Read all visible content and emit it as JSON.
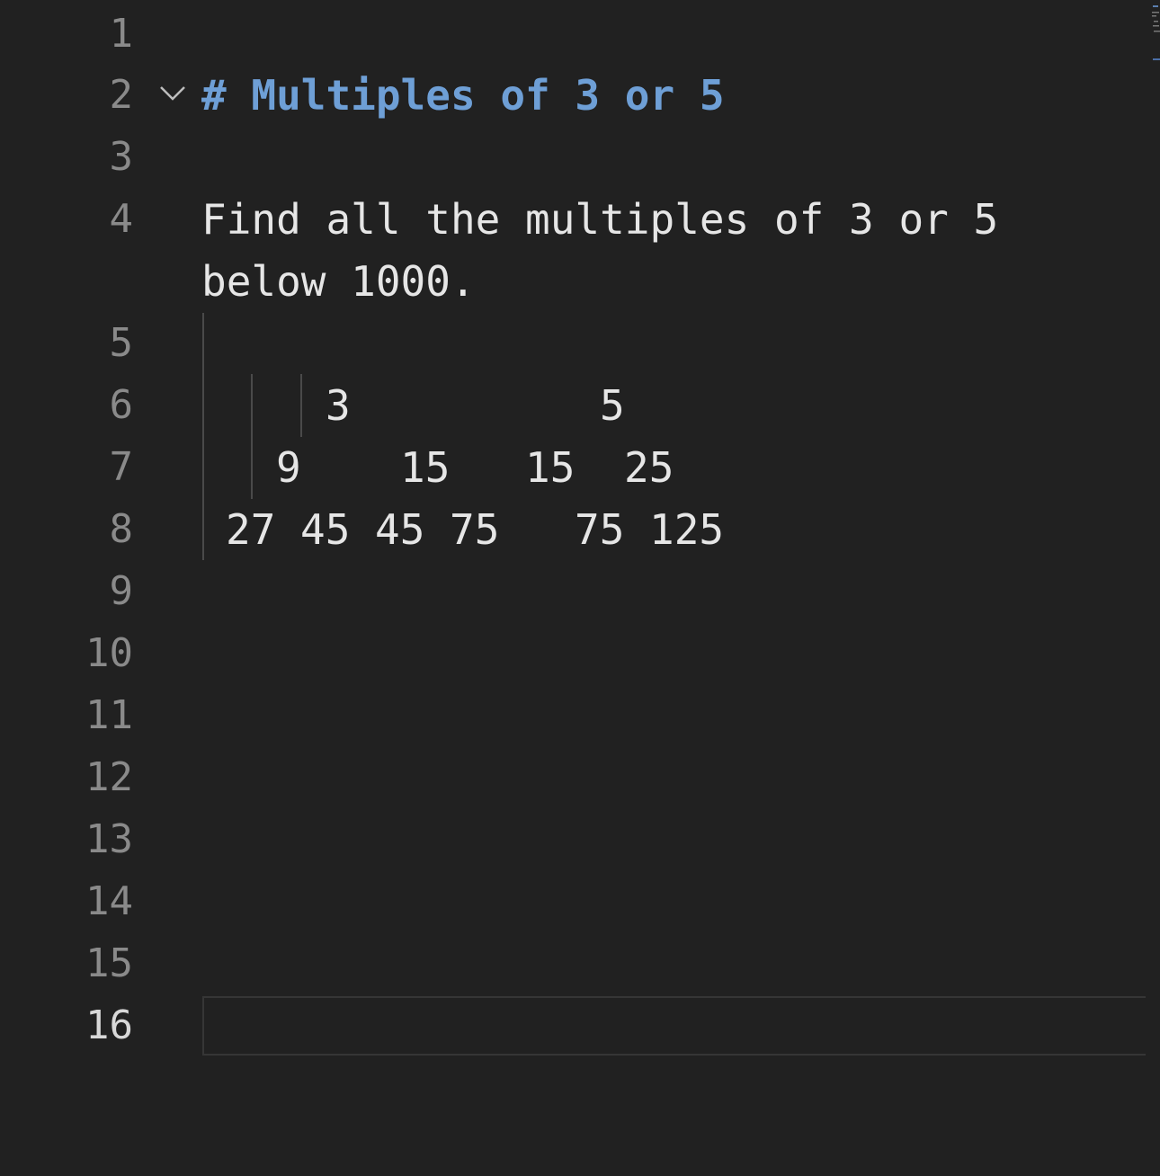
{
  "editor": {
    "line_numbers": [
      "1",
      "2",
      "3",
      "4",
      "5",
      "6",
      "7",
      "8",
      "9",
      "10",
      "11",
      "12",
      "13",
      "14",
      "15",
      "16"
    ],
    "heading": "# Multiples of 3 or 5",
    "paragraph_line_1": "Find all the multiples of 3 or 5",
    "paragraph_line_2": "below 1000.",
    "tree": {
      "row_6": [
        "3",
        "5"
      ],
      "row_7": [
        "9",
        "15",
        "15",
        "25"
      ],
      "row_8": [
        "27",
        "45",
        "45",
        "75",
        "75",
        "125"
      ]
    },
    "current_line": "16"
  },
  "colors": {
    "background": "#212121",
    "heading": "#6e9fd6",
    "text": "#e6e6e6",
    "line_number": "#8a8a8a"
  },
  "icons": {
    "fold": "chevron-down-icon"
  }
}
